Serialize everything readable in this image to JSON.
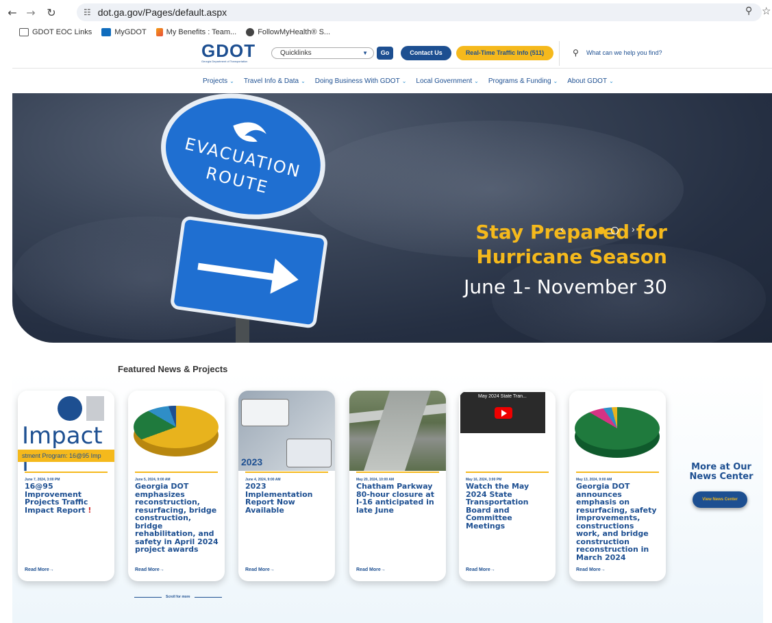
{
  "browser": {
    "url": "dot.ga.gov/Pages/default.aspx",
    "bookmarks": [
      {
        "label": "GDOT EOC Links",
        "icon": "folder-icon"
      },
      {
        "label": "MyGDOT",
        "icon": "outlook-icon"
      },
      {
        "label": "My Benefits : Team...",
        "icon": "benefits-icon"
      },
      {
        "label": "FollowMyHealth® S...",
        "icon": "health-icon"
      }
    ]
  },
  "header": {
    "logo_text": "GDOT",
    "logo_subtitle": "Georgia Department of Transportation",
    "quicklinks_label": "Quicklinks",
    "go_label": "Go",
    "contact_label": "Contact Us",
    "traffic_label": "Real-Time Traffic Info (511)",
    "search_placeholder": "What can we help you find?"
  },
  "nav": {
    "items": [
      {
        "label": "Projects"
      },
      {
        "label": "Travel Info & Data"
      },
      {
        "label": "Doing Business With GDOT"
      },
      {
        "label": "Local Government"
      },
      {
        "label": "Programs & Funding"
      },
      {
        "label": "About GDOT"
      }
    ]
  },
  "hero": {
    "sign_top": "EVACUATION ROUTE",
    "title_line1": "Stay Prepared for",
    "title_line2": "Hurricane Season",
    "dates": "June 1- November 30",
    "colors": {
      "accent": "#f5b91c",
      "brand": "#1d4f91"
    }
  },
  "news": {
    "section_title": "Featured News & Projects",
    "read_more": "Read More→",
    "scroll_hint": "Scroll for more",
    "more_title": "More at Our News Center",
    "more_button": "View News Center",
    "cards": [
      {
        "date": "June 7, 2024, 3:00 PM",
        "title": "16@95 Improvement Projects Traffic Impact Report",
        "thumb_text": "Impact I",
        "thumb_band": "stment Program: 16@95 Imp"
      },
      {
        "date": "June 5, 2024, 9:00 AM",
        "title": "Georgia DOT emphasizes reconstruction, resurfacing, bridge construction, bridge rehabilitation, and safety in April 2024 project awards"
      },
      {
        "date": "June 4, 2024, 9:00 AM",
        "title": "2023 Implementation Report Now Available",
        "thumb_text": "2023"
      },
      {
        "date": "May 20, 2024, 10:00 AM",
        "title": "Chatham Parkway 80-hour closure at I-16 anticipated in late June"
      },
      {
        "date": "May 16, 2024, 3:00 PM",
        "title": "Watch the May 2024 State Transportation Board and Committee Meetings",
        "video_title": "May 2024 State Tran..."
      },
      {
        "date": "May 13, 2024, 9:00 AM",
        "title": "Georgia DOT announces emphasis on resurfacing, safety improvements, constructions work, and bridge construction reconstruction in March 2024"
      }
    ]
  }
}
